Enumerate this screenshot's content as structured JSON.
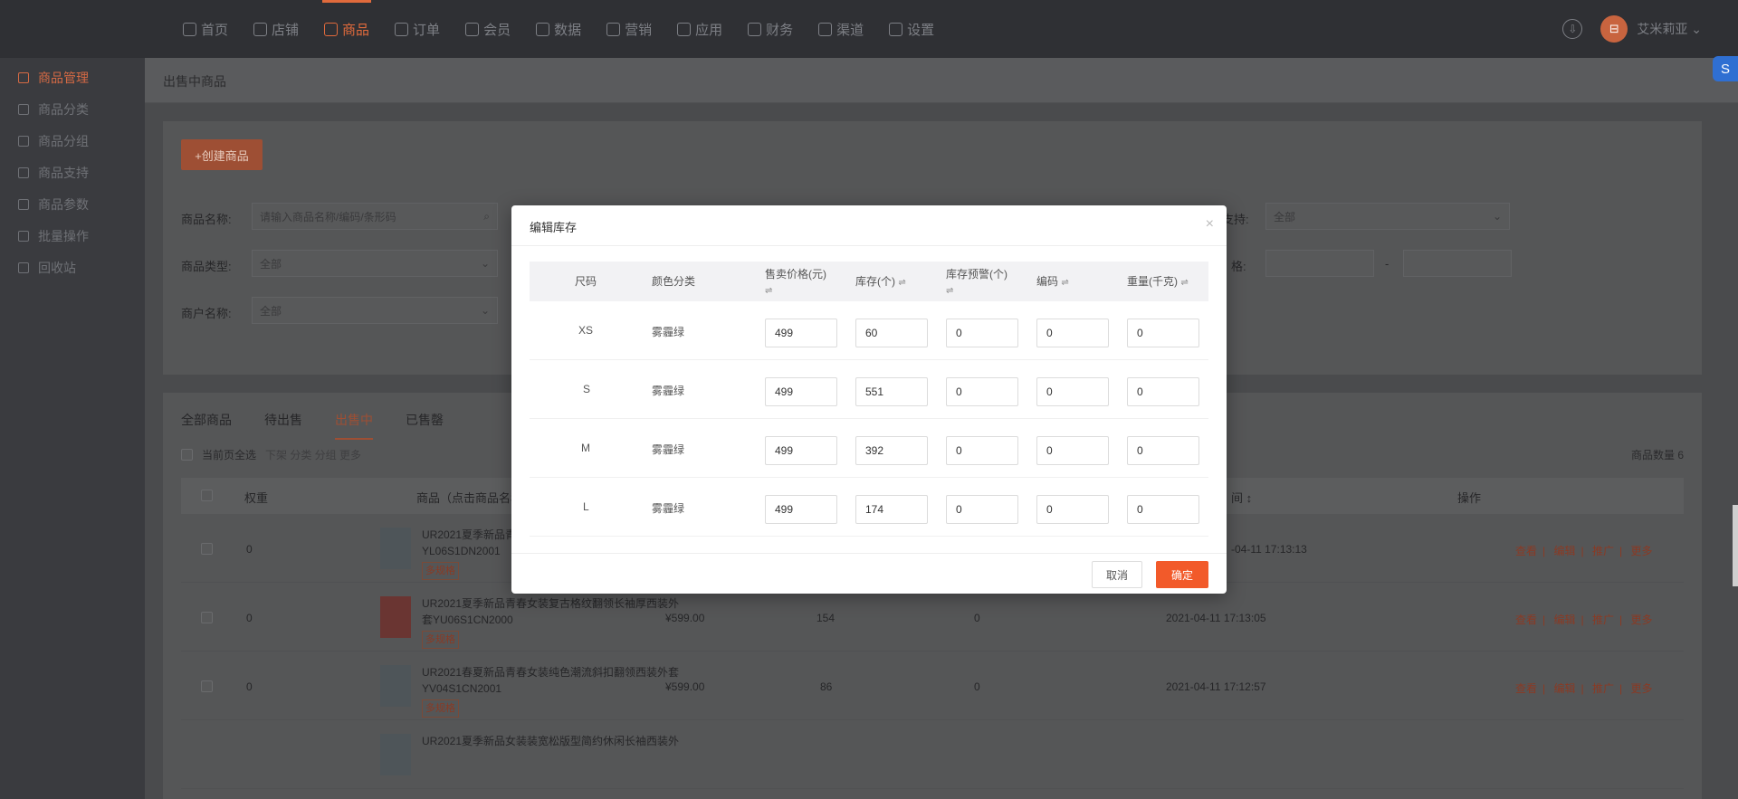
{
  "nav": {
    "items": [
      {
        "label": "首页"
      },
      {
        "label": "店铺"
      },
      {
        "label": "商品"
      },
      {
        "label": "订单"
      },
      {
        "label": "会员"
      },
      {
        "label": "数据"
      },
      {
        "label": "营销"
      },
      {
        "label": "应用"
      },
      {
        "label": "财务"
      },
      {
        "label": "渠道"
      },
      {
        "label": "设置"
      }
    ],
    "active_index": 2,
    "username": "艾米莉亚 ⌄"
  },
  "sidebar": {
    "items": [
      {
        "label": "商品管理"
      },
      {
        "label": "商品分类"
      },
      {
        "label": "商品分组"
      },
      {
        "label": "商品支持"
      },
      {
        "label": "商品参数"
      },
      {
        "label": "批量操作"
      },
      {
        "label": "回收站"
      }
    ]
  },
  "main": {
    "breadcrumb": "出售中商品",
    "create_button": "+创建商品",
    "filters": {
      "name_label": "商品名称:",
      "name_placeholder": "请输入商品名称/编码/条形码",
      "type_label": "商品类型:",
      "type_value": "全部",
      "merchant_label": "商户名称:",
      "merchant_value": "全部",
      "support_label_tail": "支持:",
      "support_value": "全部",
      "price_label_tail": "格:",
      "price_sep": "-"
    },
    "tabs": [
      {
        "label": "全部商品"
      },
      {
        "label": "待出售"
      },
      {
        "label": "出售中"
      },
      {
        "label": "已售罄"
      }
    ],
    "bulk": {
      "select_all": "当前页全选",
      "actions": "下架 分类 分组 更多"
    },
    "count": "商品数量 6",
    "columns": {
      "weight": "权重",
      "product": "商品（点击商品名称",
      "time_tail": "间 ↕",
      "ops": "操作"
    },
    "rows": [
      {
        "weight": "0",
        "name": "UR2021夏季新品青春",
        "name2": "YL06S1DN2001",
        "tag": "多规格",
        "price": "",
        "stock": "",
        "sales": "",
        "time": "-04-11 17:13:13"
      },
      {
        "weight": "0",
        "name": "UR2021夏季新品青春女装复古格纹翻领长袖厚西装外",
        "name2": "套YU06S1CN2000",
        "tag": "多规格",
        "price": "¥599.00",
        "stock": "154",
        "sales": "0",
        "time": "2021-04-11 17:13:05"
      },
      {
        "weight": "0",
        "name": "UR2021春夏新品青春女装纯色潮流斜扣翻领西装外套",
        "name2": "YV04S1CN2001",
        "tag": "多规格",
        "price": "¥599.00",
        "stock": "86",
        "sales": "0",
        "time": "2021-04-11 17:12:57"
      },
      {
        "weight": "",
        "name": "UR2021夏季新品女装装宽松版型简约休闲长袖西装外",
        "name2": "",
        "tag": "",
        "price": "",
        "stock": "",
        "sales": "",
        "time": ""
      }
    ],
    "ops": {
      "view": "查看",
      "edit": "编辑",
      "promote": "推广",
      "more": "更多",
      "sep": "|"
    }
  },
  "modal": {
    "title": "编辑库存",
    "close": "×",
    "headers": {
      "size": "尺码",
      "color": "颜色分类",
      "price_a": "售卖价格(元)",
      "stock": "库存(个)",
      "warn_a": "库存预警(个)",
      "code": "编码",
      "weight": "重量(千克)",
      "sort_icon": "⇌"
    },
    "rows": [
      {
        "size": "XS",
        "color": "雾霾绿",
        "price": "499",
        "stock": "60",
        "warn": "0",
        "code": "0",
        "weight": "0"
      },
      {
        "size": "S",
        "color": "雾霾绿",
        "price": "499",
        "stock": "551",
        "warn": "0",
        "code": "0",
        "weight": "0"
      },
      {
        "size": "M",
        "color": "雾霾绿",
        "price": "499",
        "stock": "392",
        "warn": "0",
        "code": "0",
        "weight": "0"
      },
      {
        "size": "L",
        "color": "雾霾绿",
        "price": "499",
        "stock": "174",
        "warn": "0",
        "code": "0",
        "weight": "0"
      }
    ],
    "cancel": "取消",
    "confirm": "确定"
  },
  "widgets": {
    "edge_icon": "S",
    "download_icon": "⇩",
    "avatar_text": "⊟"
  }
}
